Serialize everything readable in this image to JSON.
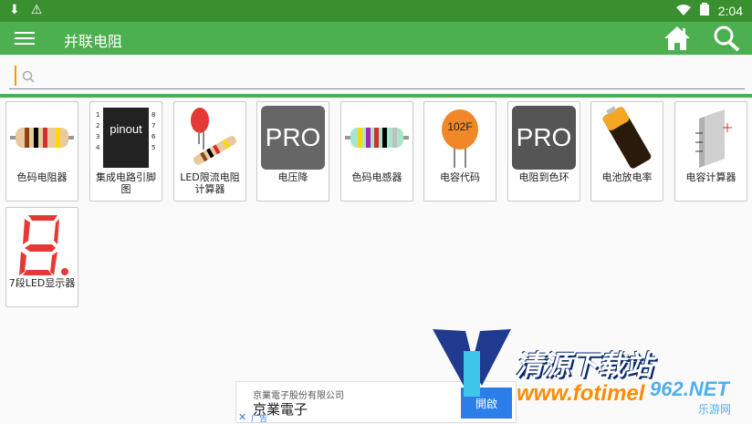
{
  "status": {
    "time": "2:04"
  },
  "appbar": {
    "title": "并联电阻"
  },
  "search": {
    "value": "",
    "placeholder": ""
  },
  "tiles": [
    {
      "label": "色码电阻器",
      "icon": "resistor-icon"
    },
    {
      "label": "集成电路引脚图",
      "icon": "ic-pinout-icon",
      "thumb_text": "pinout"
    },
    {
      "label": "LED限流电阻计算器",
      "icon": "led-resistor-icon"
    },
    {
      "label": "电压降",
      "icon": "voltage-drop-icon",
      "thumb_text": "PRO"
    },
    {
      "label": "色码电感器",
      "icon": "inductor-icon"
    },
    {
      "label": "电容代码",
      "icon": "capacitor-code-icon",
      "thumb_text": "102F"
    },
    {
      "label": "电阻到色环",
      "icon": "resistor-to-color-icon",
      "thumb_text": "PRO"
    },
    {
      "label": "电池放电率",
      "icon": "battery-icon"
    },
    {
      "label": "电容计算器",
      "icon": "capacitor-calc-icon"
    },
    {
      "label": "7段LED显示器",
      "icon": "seven-segment-icon"
    }
  ],
  "ad": {
    "company_small": "京業電子股份有限公司",
    "company": "京業電子",
    "open_label": "開啟",
    "ad_label": "广告"
  },
  "watermark": {
    "title": "清源下载站",
    "url": "www.fotimel",
    "num": "962.NET",
    "sub": "乐游网"
  },
  "colors": {
    "appbar": "#4caf50",
    "statusbar": "#3a8f2f",
    "accent": "#ff9800"
  }
}
